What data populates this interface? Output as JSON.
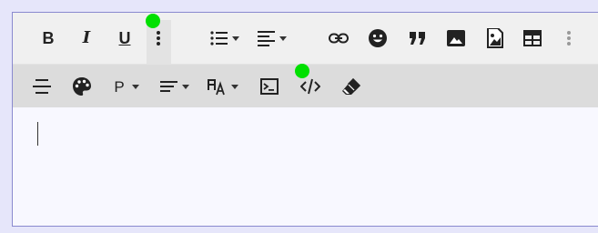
{
  "toolbar_primary": {
    "bold_label": "B",
    "italic_label": "I",
    "underline_label": "U"
  },
  "toolbar_secondary": {
    "paragraph_label": "P"
  },
  "colors": {
    "page_bg": "#e6e6fa",
    "toolbar_primary_bg": "#f0f0f0",
    "toolbar_secondary_bg": "#dcdcdc",
    "content_bg": "#f8f8ff",
    "marker": "#00e000"
  },
  "icons": [
    "bold-icon",
    "italic-icon",
    "underline-icon",
    "more-vertical-icon",
    "bullet-list-icon",
    "align-icon",
    "link-icon",
    "emoji-icon",
    "blockquote-icon",
    "image-icon",
    "file-image-icon",
    "table-icon",
    "more-vertical-icon",
    "strikethrough-icon",
    "palette-icon",
    "paragraph-format-icon",
    "text-align-icon",
    "font-size-icon",
    "code-view-icon",
    "html-code-icon",
    "eraser-icon"
  ]
}
